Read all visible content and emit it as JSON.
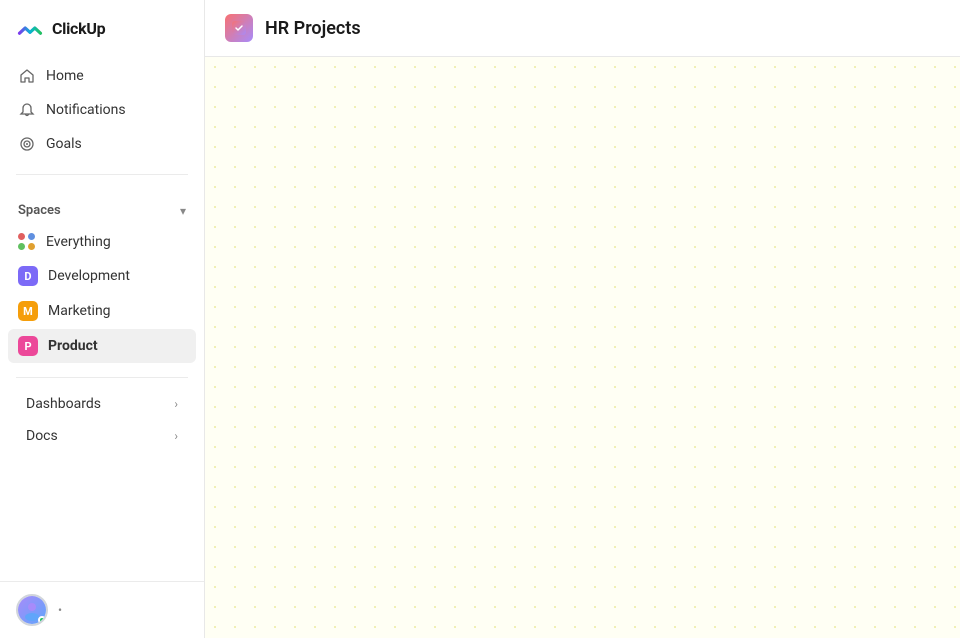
{
  "app": {
    "name": "ClickUp"
  },
  "sidebar": {
    "logo_text": "ClickUp",
    "nav_items": [
      {
        "id": "home",
        "label": "Home"
      },
      {
        "id": "notifications",
        "label": "Notifications"
      },
      {
        "id": "goals",
        "label": "Goals"
      }
    ],
    "spaces_label": "Spaces",
    "space_items": [
      {
        "id": "everything",
        "label": "Everything",
        "type": "dots"
      },
      {
        "id": "development",
        "label": "Development",
        "type": "badge",
        "badge_letter": "D",
        "badge_color": "#7c6af7"
      },
      {
        "id": "marketing",
        "label": "Marketing",
        "type": "badge",
        "badge_letter": "M",
        "badge_color": "#f59e0b"
      },
      {
        "id": "product",
        "label": "Product",
        "type": "badge",
        "badge_letter": "P",
        "badge_color": "#ec4899",
        "active": true
      }
    ],
    "expandable": [
      {
        "id": "dashboards",
        "label": "Dashboards"
      },
      {
        "id": "docs",
        "label": "Docs"
      }
    ],
    "user_status": "•"
  },
  "main": {
    "page_title": "HR Projects",
    "page_icon": "📦"
  }
}
